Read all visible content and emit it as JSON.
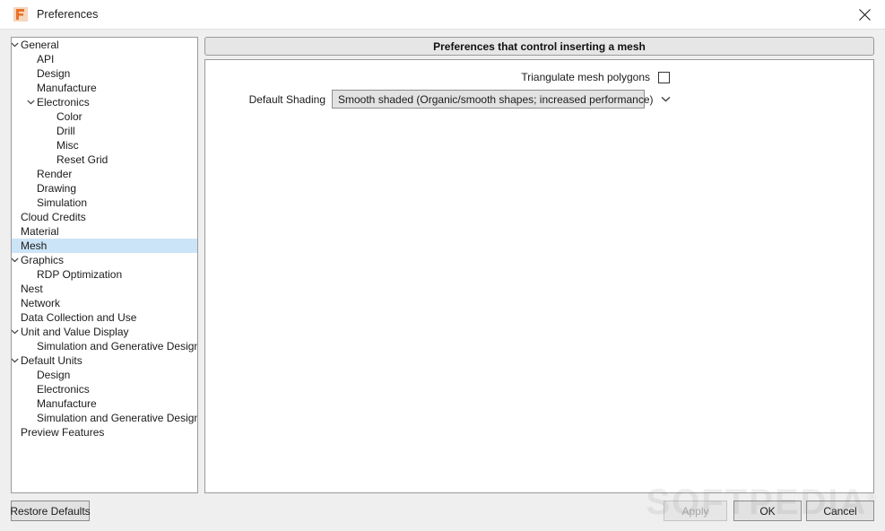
{
  "window": {
    "title": "Preferences",
    "app_icon": "fusion360-logo-icon",
    "close_icon": "close-icon"
  },
  "sidebar": {
    "items": [
      {
        "label": "General",
        "depth": 0,
        "twisty": "chevron-down-icon",
        "selected": false
      },
      {
        "label": "API",
        "depth": 1,
        "twisty": "",
        "selected": false
      },
      {
        "label": "Design",
        "depth": 1,
        "twisty": "",
        "selected": false
      },
      {
        "label": "Manufacture",
        "depth": 1,
        "twisty": "",
        "selected": false
      },
      {
        "label": "Electronics",
        "depth": 1,
        "twisty": "chevron-down-icon",
        "selected": false
      },
      {
        "label": "Color",
        "depth": 2,
        "twisty": "",
        "selected": false
      },
      {
        "label": "Drill",
        "depth": 2,
        "twisty": "",
        "selected": false
      },
      {
        "label": "Misc",
        "depth": 2,
        "twisty": "",
        "selected": false
      },
      {
        "label": "Reset Grid",
        "depth": 2,
        "twisty": "",
        "selected": false
      },
      {
        "label": "Render",
        "depth": 1,
        "twisty": "",
        "selected": false
      },
      {
        "label": "Drawing",
        "depth": 1,
        "twisty": "",
        "selected": false
      },
      {
        "label": "Simulation",
        "depth": 1,
        "twisty": "",
        "selected": false
      },
      {
        "label": "Cloud Credits",
        "depth": 0,
        "twisty": "",
        "selected": false
      },
      {
        "label": "Material",
        "depth": 0,
        "twisty": "",
        "selected": false
      },
      {
        "label": "Mesh",
        "depth": 0,
        "twisty": "",
        "selected": true
      },
      {
        "label": "Graphics",
        "depth": 0,
        "twisty": "chevron-down-icon",
        "selected": false
      },
      {
        "label": "RDP Optimization",
        "depth": 1,
        "twisty": "",
        "selected": false
      },
      {
        "label": "Nest",
        "depth": 0,
        "twisty": "",
        "selected": false
      },
      {
        "label": "Network",
        "depth": 0,
        "twisty": "",
        "selected": false
      },
      {
        "label": "Data Collection and Use",
        "depth": 0,
        "twisty": "",
        "selected": false
      },
      {
        "label": "Unit and Value Display",
        "depth": 0,
        "twisty": "chevron-down-icon",
        "selected": false
      },
      {
        "label": "Simulation and Generative Design",
        "depth": 1,
        "twisty": "",
        "selected": false
      },
      {
        "label": "Default Units",
        "depth": 0,
        "twisty": "chevron-down-icon",
        "selected": false
      },
      {
        "label": "Design",
        "depth": 1,
        "twisty": "",
        "selected": false
      },
      {
        "label": "Electronics",
        "depth": 1,
        "twisty": "",
        "selected": false
      },
      {
        "label": "Manufacture",
        "depth": 1,
        "twisty": "",
        "selected": false
      },
      {
        "label": "Simulation and Generative Design",
        "depth": 1,
        "twisty": "",
        "selected": false
      },
      {
        "label": "Preview Features",
        "depth": 0,
        "twisty": "",
        "selected": false
      }
    ]
  },
  "content": {
    "group_title": "Preferences that control inserting a mesh",
    "triangulate": {
      "label": "Triangulate mesh polygons",
      "checked": false
    },
    "default_shading": {
      "label": "Default Shading",
      "value": "Smooth shaded (Organic/smooth shapes; increased performance)",
      "arrow_icon": "chevron-down-icon"
    }
  },
  "footer": {
    "restore_defaults": "Restore Defaults",
    "apply": "Apply",
    "apply_disabled": true,
    "ok": "OK",
    "cancel": "Cancel"
  },
  "watermark": {
    "text": "SOFTPEDIA"
  },
  "colors": {
    "selection": "#cce4f7",
    "dialog_bg": "#efefef",
    "panel_bg": "#ffffff",
    "border": "#9a9a9a",
    "control_bg": "#e2e2e2"
  }
}
